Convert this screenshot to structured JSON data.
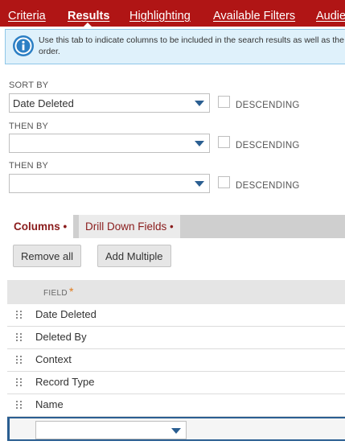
{
  "tabs": [
    {
      "label": "Criteria",
      "active": false
    },
    {
      "label": "Results",
      "active": true
    },
    {
      "label": "Highlighting",
      "active": false
    },
    {
      "label": "Available Filters",
      "active": false
    },
    {
      "label": "Audience",
      "active": false
    }
  ],
  "banner": {
    "icon": "info-icon",
    "text": "Use this tab to indicate columns to be included in the search results as well as the sort order."
  },
  "sort": {
    "sort_by_label": "SORT BY",
    "sort_by_value": "Date Deleted",
    "then_by_label_1": "THEN BY",
    "then_by_value_1": "",
    "then_by_label_2": "THEN BY",
    "then_by_value_2": "",
    "descending_label": "DESCENDING"
  },
  "subtabs": [
    {
      "label": "Columns •",
      "active": true
    },
    {
      "label": "Drill Down Fields •",
      "active": false
    }
  ],
  "buttons": {
    "remove_all": "Remove all",
    "add_multiple": "Add Multiple"
  },
  "table": {
    "field_header": "FIELD",
    "required_mark": "*",
    "rows": [
      "Date Deleted",
      "Deleted By",
      "Context",
      "Record Type",
      "Name"
    ],
    "new_row_value": ""
  },
  "colors": {
    "tab_bar": "#b01515",
    "banner_bg": "#dff1fb",
    "info_icon": "#2c7fc4",
    "required": "#e07a1a"
  }
}
